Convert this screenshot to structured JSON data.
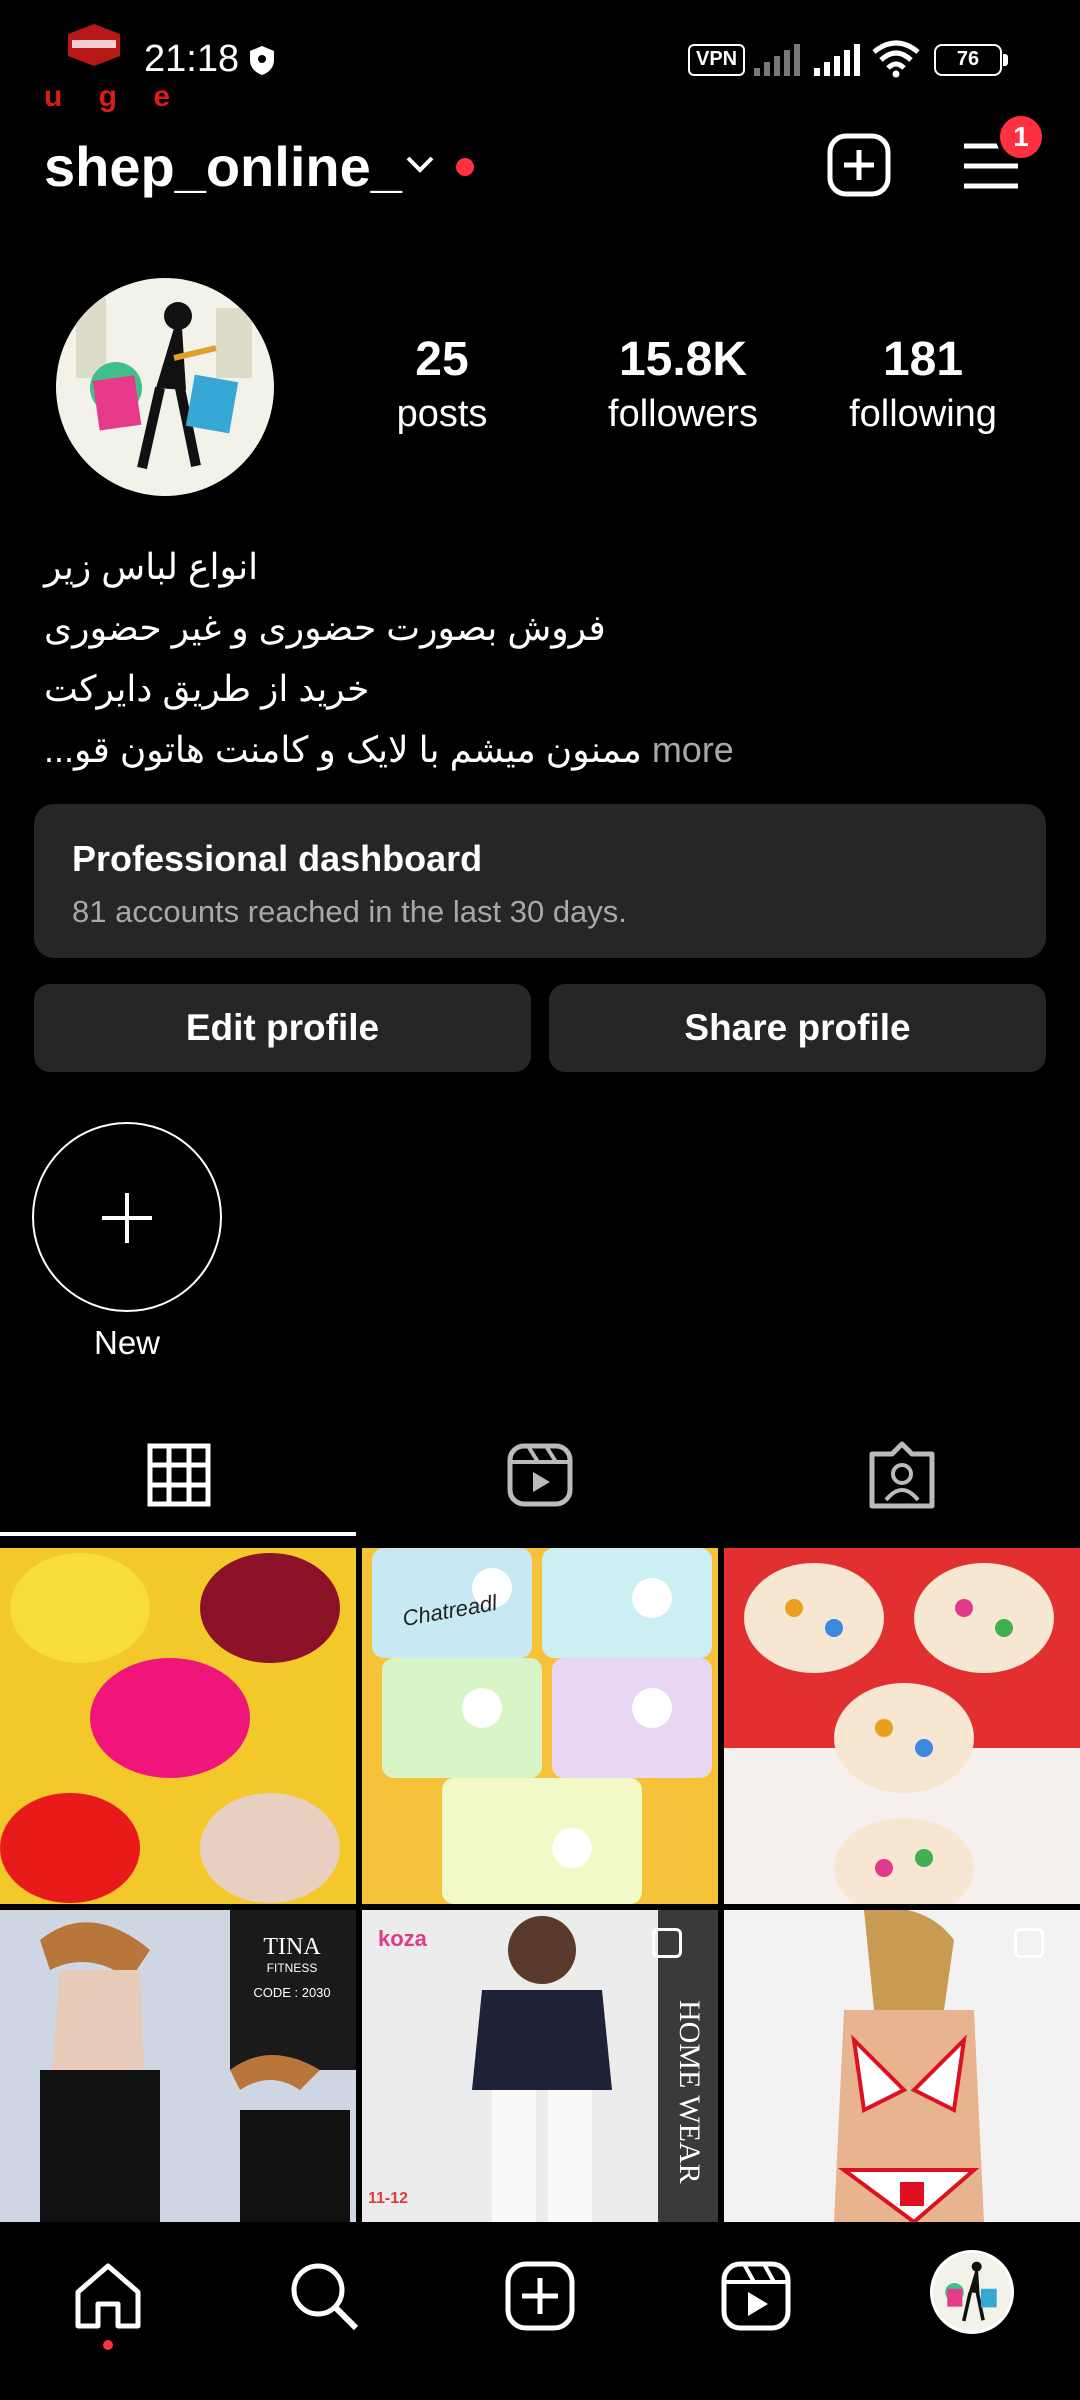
{
  "status_bar": {
    "time": "21:18",
    "brand": "u g e",
    "vpn_label": "VPN",
    "battery": "76"
  },
  "header": {
    "username": "shep_online_",
    "menu_badge": "1"
  },
  "profile": {
    "stats": [
      {
        "value": "25",
        "label": "posts"
      },
      {
        "value": "15.8K",
        "label": "followers"
      },
      {
        "value": "181",
        "label": "following"
      }
    ],
    "bio_lines": [
      "انواع لباس زیر",
      "فروش بصورت حضوری و غیر حضوری",
      "خرید از طریق دایرکت",
      "ممنون میشم با لایک و کامنت هاتون قو..."
    ],
    "bio_more": "more"
  },
  "dashboard": {
    "title": "Professional dashboard",
    "subtitle": "81 accounts reached in the last 30 days."
  },
  "actions": {
    "edit_label": "Edit profile",
    "share_label": "Share profile"
  },
  "highlights": {
    "new_label": "New"
  },
  "tabs": [
    {
      "icon": "grid-icon",
      "active": true
    },
    {
      "icon": "reels-icon",
      "active": false
    },
    {
      "icon": "tagged-icon",
      "active": false
    }
  ],
  "posts": [
    {
      "caption": ""
    },
    {
      "caption": "Chatreadl"
    },
    {
      "caption": ""
    },
    {
      "caption": "TINA FITNESS CODE : 2030"
    },
    {
      "caption": "koza HOME WEAR"
    },
    {
      "caption": ""
    }
  ],
  "post_texts": {
    "p2": "Chatreadl",
    "p4_brand": "TINA",
    "p4_sub": "FITNESS",
    "p4_code": "CODE : 2030",
    "p5_brand": "koza",
    "p5_side": "HOME WEAR",
    "p5_size": "11-12"
  },
  "bottom_nav": [
    "home-icon",
    "search-icon",
    "create-icon",
    "reels-icon",
    "profile-avatar"
  ],
  "colors": {
    "background": "#000000",
    "surface": "#262626",
    "accent_red": "#ff3040",
    "muted_text": "#a8a8a8"
  }
}
